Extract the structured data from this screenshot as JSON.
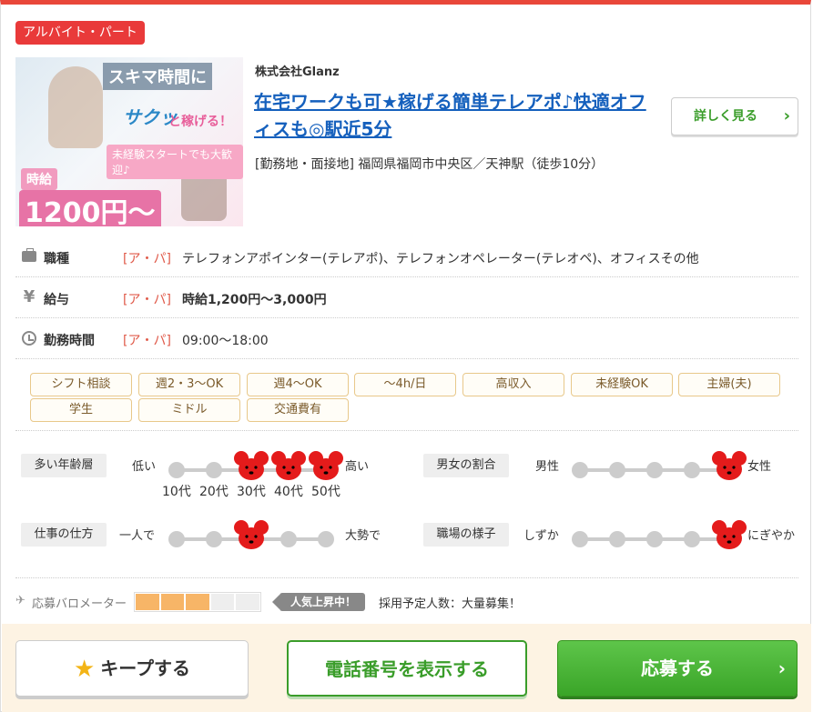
{
  "job": {
    "employment_type": "アルバイト・パート",
    "company": "株式会社Glanz",
    "title": "在宅ワークも可★稼げる簡単テレアポ♪快適オフィスも◎駅近5分",
    "location": "[勤務地・面接地] 福岡県福岡市中央区／天神駅（徒歩10分）",
    "detail_label": "詳しく見る"
  },
  "thumbnail": {
    "top_text": "スキマ時間に",
    "saku_text": "サクッ",
    "kasegu_text": "と稼げる！",
    "mikeiken_text": "未経験スタートでも大歓迎♪",
    "wage_label": "時給",
    "wage_text": "1200円〜"
  },
  "info_rows": [
    {
      "label": "職種",
      "tag": "[ア・パ]",
      "value": "テレフォンアポインター(テレアポ)、テレフォンオペレーター(テレオペ)、オフィスその他",
      "icon": "briefcase-icon"
    },
    {
      "label": "給与",
      "tag": "[ア・パ]",
      "value": "時給1,200円〜3,000円",
      "icon": "yen-icon"
    },
    {
      "label": "勤務時間",
      "tag": "[ア・パ]",
      "value": "09:00〜18:00",
      "icon": "clock-icon"
    }
  ],
  "features": [
    "シフト相談",
    "週2・3〜OK",
    "週4〜OK",
    "〜4h/日",
    "高収入",
    "未経験OK",
    "主婦(夫)",
    "学生",
    "ミドル",
    "交通費有"
  ],
  "scales": {
    "age": {
      "label": "多い年齢層",
      "left": "低い",
      "right": "高い",
      "ticks": [
        "10代",
        "20代",
        "30代",
        "40代",
        "50代"
      ],
      "active": [
        3,
        4,
        5
      ]
    },
    "gender": {
      "label": "男女の割合",
      "left": "男性",
      "right": "女性",
      "active": [
        5
      ]
    },
    "work_style": {
      "label": "仕事の仕方",
      "left": "一人で",
      "right": "大勢で",
      "active": [
        3
      ]
    },
    "atmosphere": {
      "label": "職場の様子",
      "left": "しずか",
      "right": "にぎやか",
      "active": [
        5
      ]
    }
  },
  "barometer": {
    "label": "応募バロメーター",
    "level": 3,
    "max": 5,
    "status": "人気上昇中！",
    "plan": "採用予定人数：大量募集！"
  },
  "actions": {
    "keep": "キープする",
    "phone": "電話番号を表示する",
    "apply": "応募する"
  },
  "colors": {
    "accent_red": "#e93a3a",
    "link_blue": "#1560bd",
    "green": "#3a9d2a",
    "mouse_red": "#e41b1b"
  }
}
